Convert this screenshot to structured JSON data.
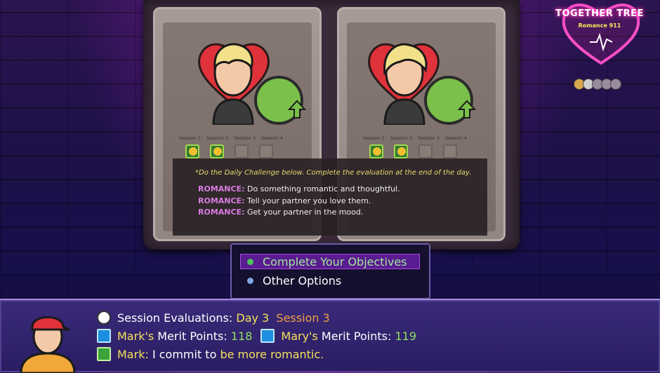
{
  "logo": {
    "title": "TOGETHER TREE",
    "subtitle": "Romance 911"
  },
  "panels": [
    {
      "sessions": [
        "Session 1",
        "Session 2",
        "Session 3",
        "Session 4"
      ],
      "completed": 2
    },
    {
      "sessions": [
        "Session 1",
        "Session 2",
        "Session 3",
        "Session 4"
      ],
      "completed": 2
    }
  ],
  "challenge": {
    "hint": "*Do the Daily Challenge below. Complete the evaluation at the end of the day.",
    "objectives": [
      {
        "tag": "ROMANCE:",
        "text": " Do something romantic and thoughtful."
      },
      {
        "tag": "ROMANCE:",
        "text": " Tell your partner you love them."
      },
      {
        "tag": "ROMANCE:",
        "text": " Get your partner in the mood."
      }
    ]
  },
  "menu": {
    "options": [
      "Complete Your Objectives",
      "Other Options"
    ],
    "selected_index": 0
  },
  "dialog": {
    "evaluations_label": "Session Evaluations:",
    "day": "Day 3",
    "session": "Session 3",
    "mark_name": "Mark's",
    "merit_label": "Merit Points:",
    "mark_points": "118",
    "mary_name": "Mary's",
    "mary_points": "119",
    "commit_name": "Mark:",
    "commit_text": "I commit to",
    "commit_goal": "be more romantic."
  },
  "colors": {
    "accent": "#d77ce0",
    "selected_bg": "#5a1c90",
    "dialog_bg": "#2a1d62",
    "highlight_green": "#8ee060",
    "highlight_yellow": "#f5e05a"
  },
  "icons": [
    "heart-neon-logo-icon",
    "clock-icon",
    "tree-icon",
    "hand-icon",
    "sprout-badge-icon",
    "arrow-up-icon"
  ]
}
